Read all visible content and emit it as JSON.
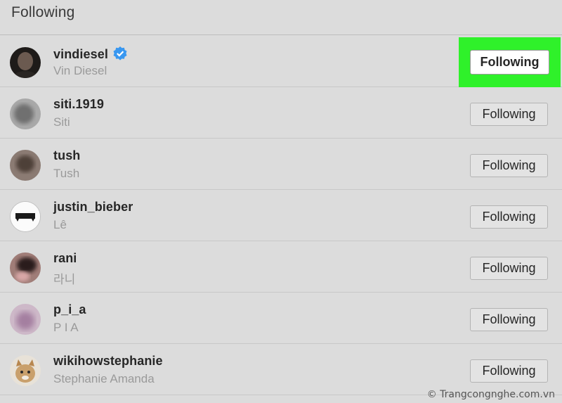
{
  "header": {
    "title": "Following"
  },
  "accounts": [
    {
      "username": "vindiesel",
      "name": "Vin Diesel",
      "verified": true,
      "button": "Following",
      "highlighted": true,
      "avatar_color": "#3a3532"
    },
    {
      "username": "siti.1919",
      "name": "Siti",
      "verified": false,
      "button": "Following",
      "highlighted": false,
      "avatar_color": "#8a8a8a"
    },
    {
      "username": "tush",
      "name": "Tush",
      "verified": false,
      "button": "Following",
      "highlighted": false,
      "avatar_color": "#6e5a52"
    },
    {
      "username": "justin_bieber",
      "name": "Lê",
      "verified": false,
      "button": "Following",
      "highlighted": false,
      "avatar_color": "#ffffff"
    },
    {
      "username": "rani",
      "name": "라니",
      "verified": false,
      "button": "Following",
      "highlighted": false,
      "avatar_color": "#5b3e3e"
    },
    {
      "username": "p_i_a",
      "name": "P I A",
      "verified": false,
      "button": "Following",
      "highlighted": false,
      "avatar_color": "#b59ab0"
    },
    {
      "username": "wikihowstephanie",
      "name": "Stephanie Amanda",
      "verified": false,
      "button": "Following",
      "highlighted": false,
      "avatar_color": "#c9b49a"
    }
  ],
  "watermark": "© Trangcongnghe.com.vn",
  "colors": {
    "highlight": "#2ff12a",
    "verified_badge": "#3897f0"
  }
}
